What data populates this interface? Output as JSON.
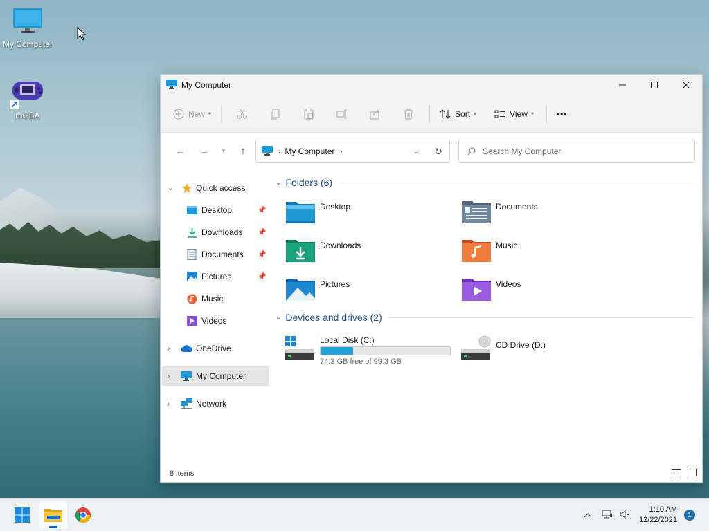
{
  "desktop": {
    "icons": [
      {
        "label": "My Computer",
        "icon": "monitor-icon"
      },
      {
        "label": "mGBA",
        "icon": "gameboy-advance-icon"
      }
    ]
  },
  "window": {
    "title": "My Computer",
    "controls": {
      "minimize": "minimize-icon",
      "maximize": "maximize-icon",
      "close": "close-icon"
    },
    "toolbar": {
      "new_label": "New",
      "sort_label": "Sort",
      "view_label": "View",
      "more_label": "•••"
    },
    "address": {
      "crumb": "My Computer",
      "separator": "›",
      "search_placeholder": "Search My Computer"
    },
    "sidebar": {
      "quick_access": "Quick access",
      "pinned": [
        {
          "label": "Desktop",
          "pinned": true
        },
        {
          "label": "Downloads",
          "pinned": true
        },
        {
          "label": "Documents",
          "pinned": true
        },
        {
          "label": "Pictures",
          "pinned": true
        },
        {
          "label": "Music",
          "pinned": false
        },
        {
          "label": "Videos",
          "pinned": false
        }
      ],
      "onedrive": "OneDrive",
      "my_computer": "My Computer",
      "network": "Network"
    },
    "folders_header": "Folders (6)",
    "folders": [
      {
        "name": "Desktop",
        "icon": "desktop-folder-icon",
        "color": "#1e9ad6"
      },
      {
        "name": "Documents",
        "icon": "documents-folder-icon",
        "color": "#5f7a93"
      },
      {
        "name": "Downloads",
        "icon": "downloads-folder-icon",
        "color": "#1aa37a"
      },
      {
        "name": "Music",
        "icon": "music-folder-icon",
        "color": "#e8643a"
      },
      {
        "name": "Pictures",
        "icon": "pictures-folder-icon",
        "color": "#1e86d0"
      },
      {
        "name": "Videos",
        "icon": "videos-folder-icon",
        "color": "#8a4fd6"
      }
    ],
    "drives_header": "Devices and drives (2)",
    "drives": [
      {
        "name": "Local Disk (C:)",
        "free_text": "74.3 GB free of 99.3 GB",
        "used_fraction": 0.252,
        "icon": "local-disk-icon"
      },
      {
        "name": "CD Drive (D:)",
        "icon": "cd-drive-icon"
      }
    ],
    "status": {
      "items": "8 items"
    }
  },
  "taskbar": {
    "apps": [
      "start-icon",
      "file-explorer-icon",
      "chrome-icon"
    ],
    "time": "1:10 AM",
    "date": "12/22/2021",
    "notifications": "1",
    "accent": "#0067c0"
  }
}
